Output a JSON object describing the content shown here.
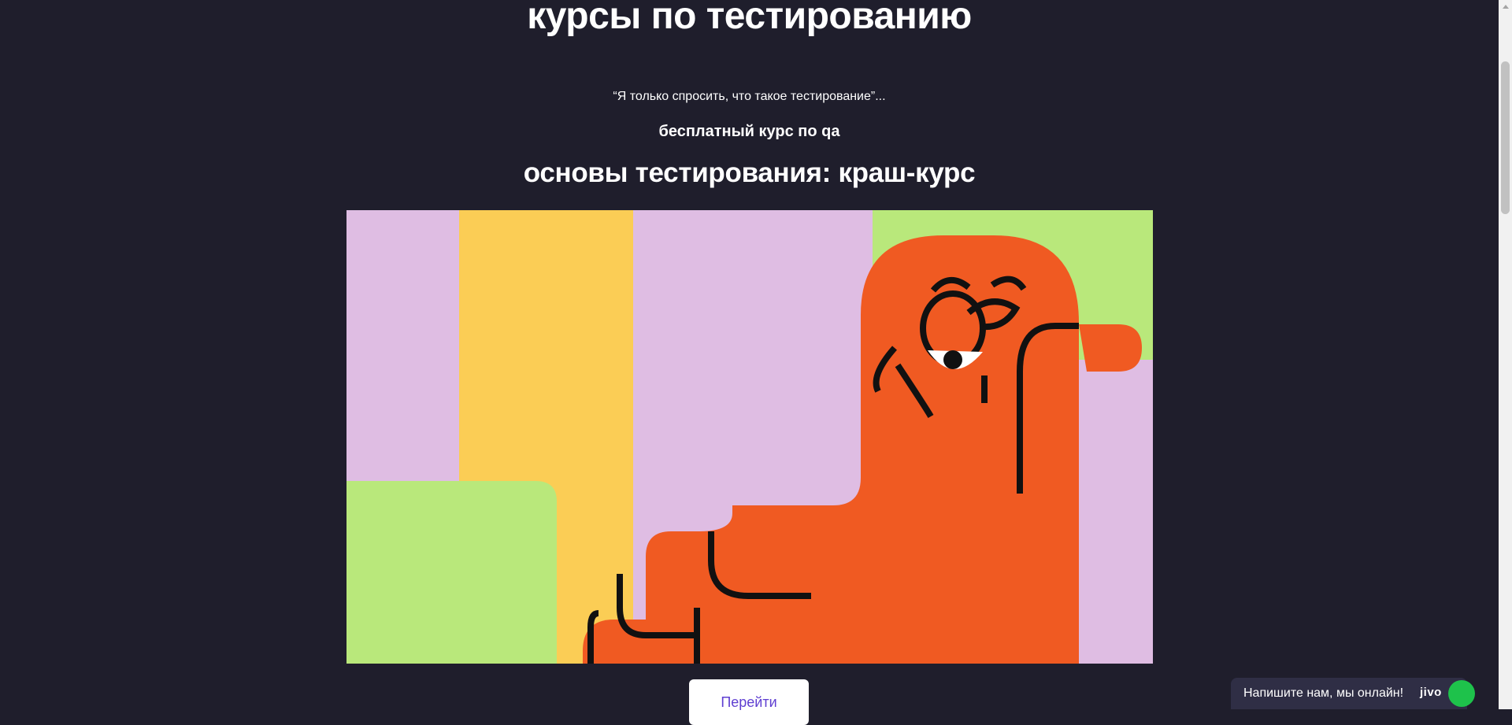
{
  "hero": {
    "title": "курсы по тестированию"
  },
  "course": {
    "quote": "“Я только спросить, что такое тестирование”...",
    "subtitle": "бесплатный курс по qa",
    "title": "основы тестирования: краш-курс",
    "banner_icon": "lazy-orange-character-illustration",
    "colors": {
      "background": "#1f1e2c",
      "lilac": "#dfbde3",
      "yellow": "#fbcd55",
      "green": "#b9e87b",
      "orange": "#f05a22"
    },
    "button_label": "Перейти",
    "button_color": "#5f3fd1"
  },
  "chat": {
    "label": "Напишите нам, мы онлайн!",
    "logo": "jivo",
    "status_color": "#1ec24b"
  }
}
